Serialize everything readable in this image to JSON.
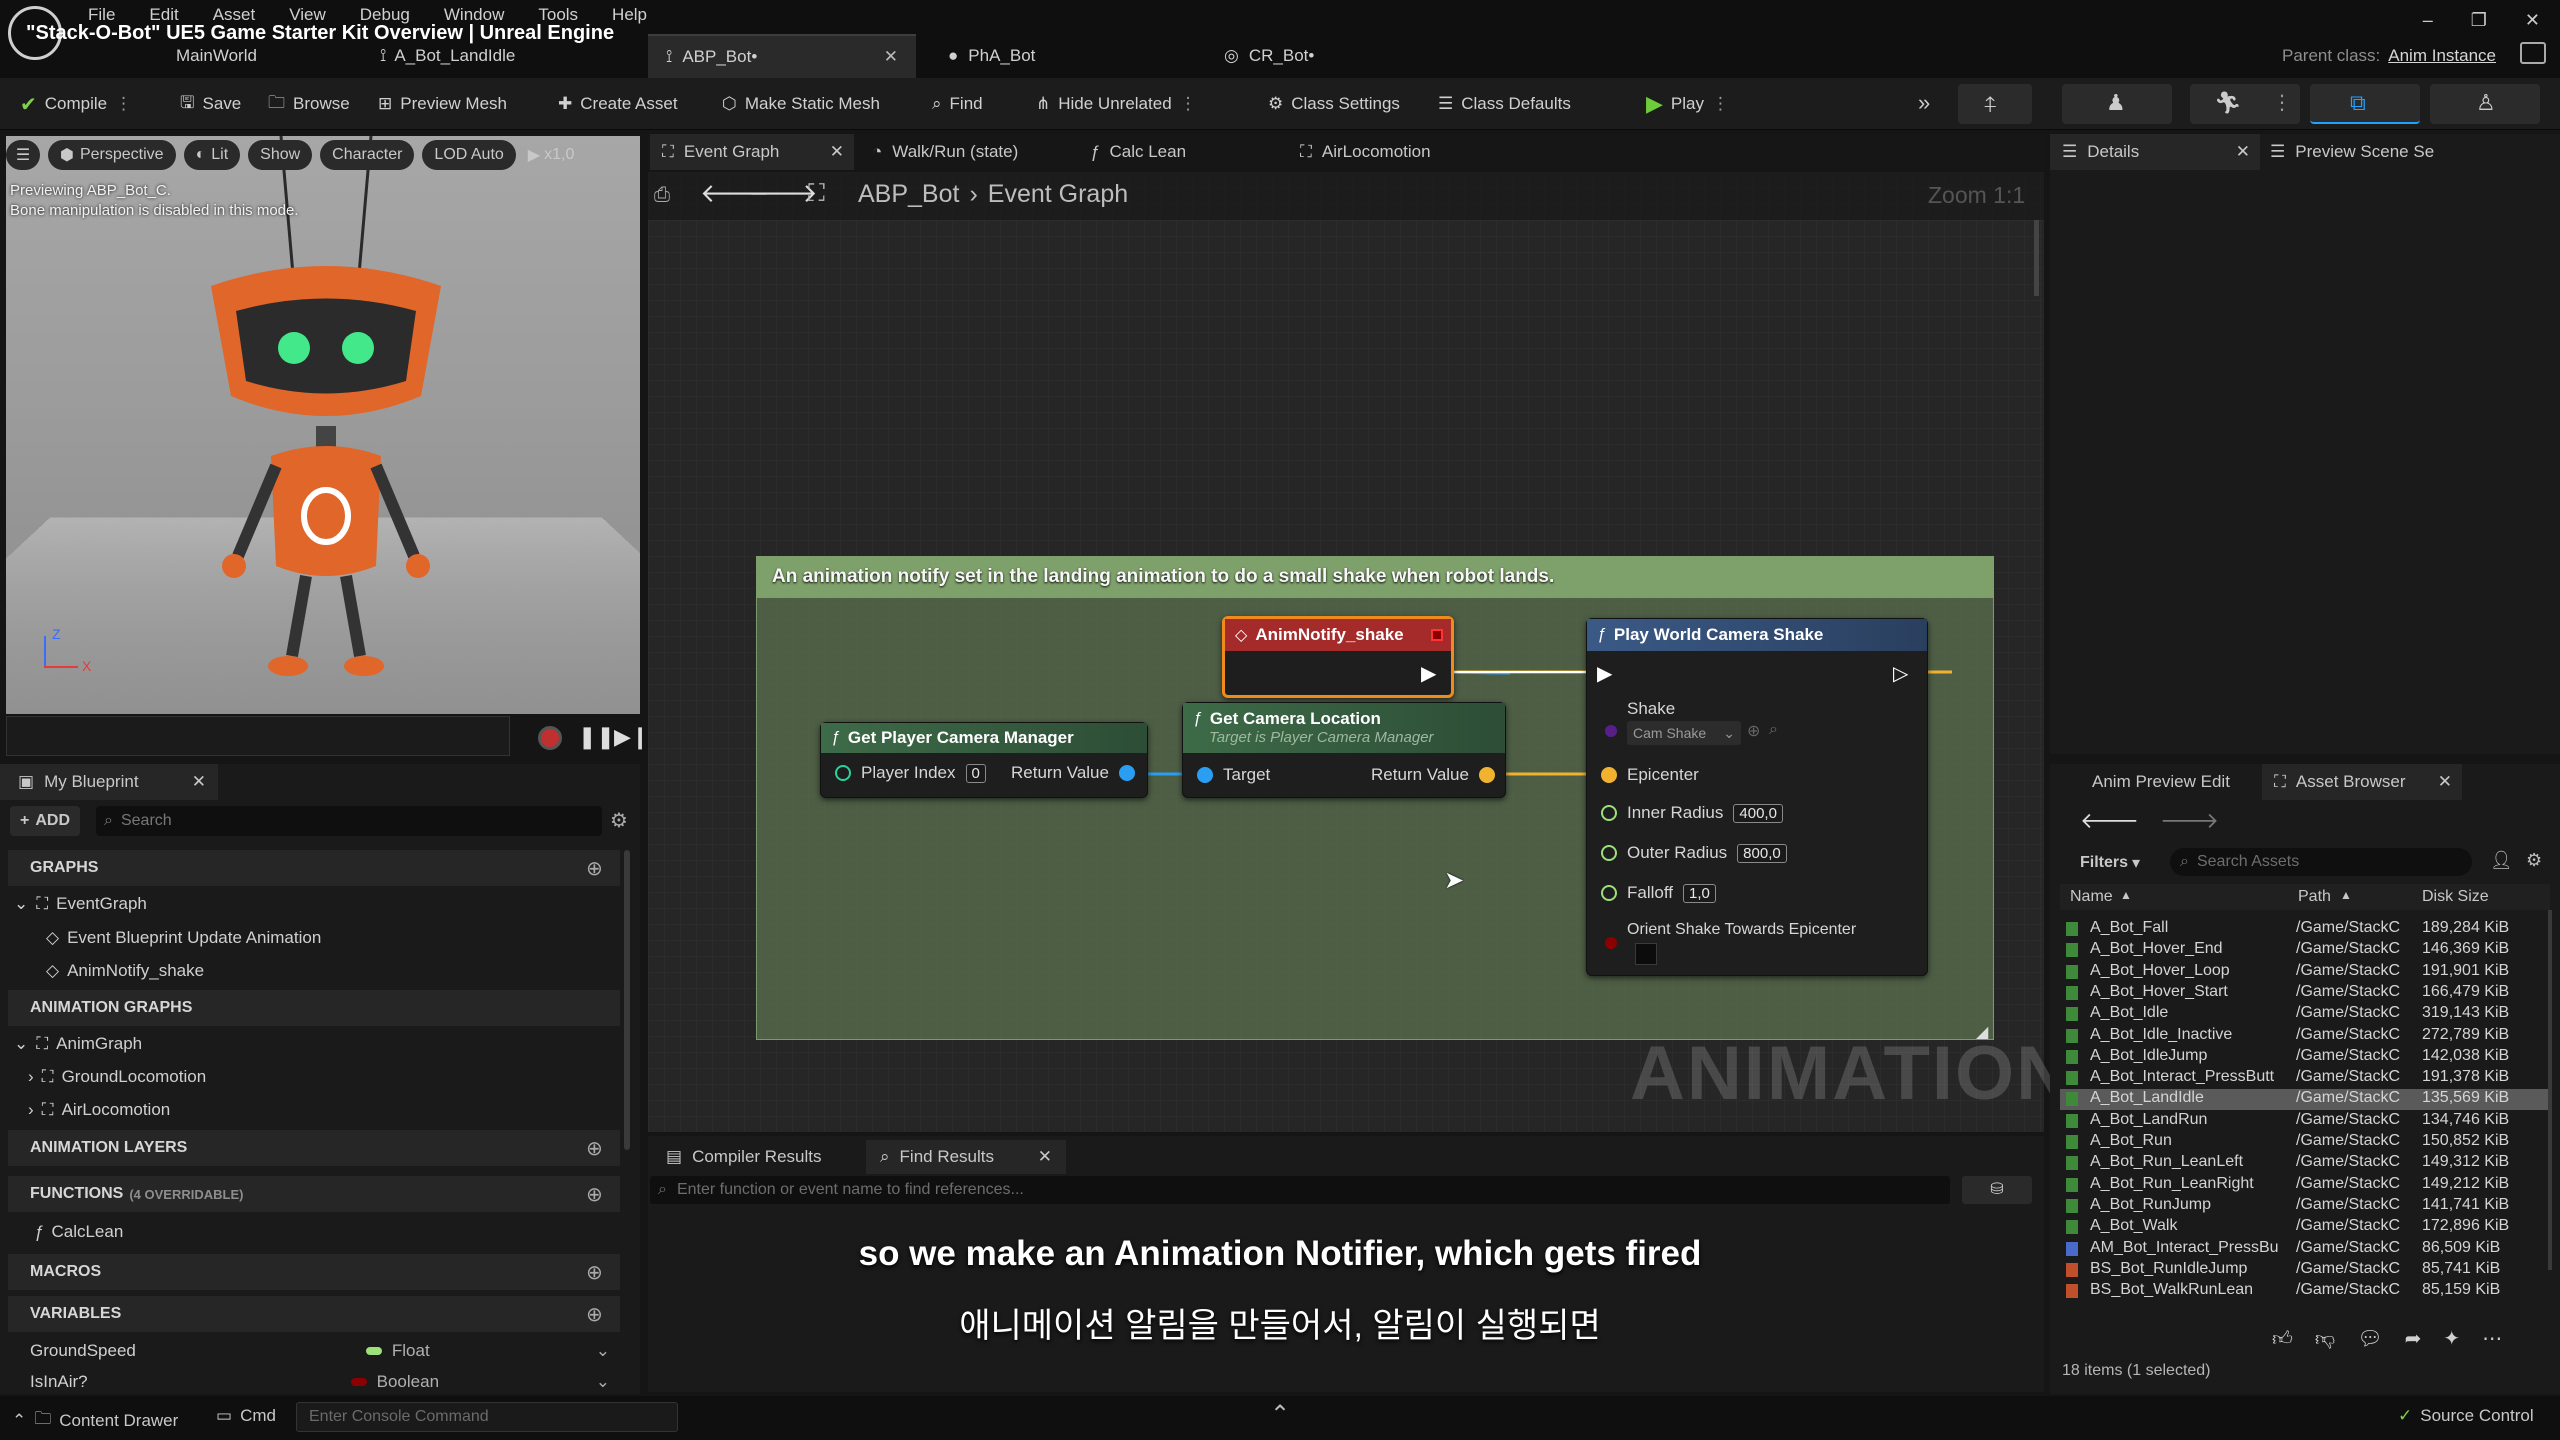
{
  "app": {
    "title": "\"Stack-O-Bot\" UE5 Game Starter Kit Overview | Unreal Engine",
    "main_world": "MainWorld",
    "tab_landidle": "A_Bot_LandIdle",
    "parent_class_label": "Parent class:",
    "parent_class_value": "Anim Instance"
  },
  "menu": [
    "File",
    "Edit",
    "Asset",
    "View",
    "Debug",
    "Window",
    "Tools",
    "Help"
  ],
  "doc_tabs": [
    "ABP_Bot•",
    "PhA_Bot",
    "CR_Bot•"
  ],
  "toolbar": {
    "compile": "Compile",
    "save": "Save",
    "browse": "Browse",
    "preview_mesh": "Preview Mesh",
    "create_asset": "Create Asset",
    "make_static_mesh": "Make Static Mesh",
    "find": "Find",
    "hide_unrelated": "Hide Unrelated",
    "class_settings": "Class Settings",
    "class_defaults": "Class Defaults",
    "play": "Play"
  },
  "viewport": {
    "perspective": "Perspective",
    "lit": "Lit",
    "show": "Show",
    "character": "Character",
    "lod": "LOD Auto",
    "speed": "x1,0",
    "preview_line1": "Previewing ABP_Bot_C.",
    "preview_line2": "Bone manipulation is disabled in this mode.",
    "axis_z": "Z",
    "axis_x": "X"
  },
  "my_blueprint": {
    "title": "My Blueprint",
    "add": "ADD",
    "search_placeholder": "Search",
    "graphs": "GRAPHS",
    "event_graph": "EventGraph",
    "event_bp_update": "Event Blueprint Update Animation",
    "anim_notify": "AnimNotify_shake",
    "animation_graphs": "ANIMATION GRAPHS",
    "anim_graph": "AnimGraph",
    "ground_locomotion": "GroundLocomotion",
    "air_locomotion": "AirLocomotion",
    "animation_layers": "ANIMATION LAYERS",
    "functions": "FUNCTIONS",
    "functions_note": "(4 OVERRIDABLE)",
    "calc_lean": "CalcLean",
    "macros": "MACROS",
    "variables": "VARIABLES",
    "var1_name": "GroundSpeed",
    "var1_type": "Float",
    "var2_name": "IsInAir?",
    "var2_type": "Boolean"
  },
  "graph_tabs": [
    "Event Graph",
    "Walk/Run (state)",
    "Calc Lean",
    "AirLocomotion"
  ],
  "breadcrumb": {
    "bp": "ABP_Bot",
    "graph": "Event Graph",
    "zoom": "Zoom 1:1"
  },
  "comment": "An animation notify set in the landing animation to do a small shake when robot lands.",
  "nodes": {
    "anim_notify": "AnimNotify_shake",
    "get_pcm": {
      "title": "Get Player Camera Manager",
      "player_index": "Player Index",
      "player_index_val": "0",
      "return_value": "Return Value"
    },
    "get_cam_loc": {
      "title": "Get Camera Location",
      "subtitle": "Target is Player Camera Manager",
      "target": "Target",
      "return_value": "Return Value"
    },
    "play_shake": {
      "title": "Play World Camera Shake",
      "shake": "Shake",
      "shake_val": "Cam Shake",
      "epicenter": "Epicenter",
      "inner_radius": "Inner Radius",
      "inner_radius_val": "400,0",
      "outer_radius": "Outer Radius",
      "outer_radius_val": "800,0",
      "falloff": "Falloff",
      "falloff_val": "1,0",
      "orient": "Orient Shake Towards Epicenter"
    }
  },
  "watermark": "ANIMATION",
  "bottom_tabs": {
    "compiler_results": "Compiler Results",
    "find_results": "Find Results",
    "find_placeholder": "Enter function or event name to find references..."
  },
  "subtitles": {
    "en": "so we make an Animation Notifier, which gets fired",
    "ko": "애니메이션 알림을 만들어서, 알림이 실행되면"
  },
  "details": {
    "title": "Details",
    "preview_scene": "Preview Scene Se"
  },
  "asset_browser": {
    "anim_preview_tab": "Anim Preview Edit",
    "title": "Asset Browser",
    "filters": "Filters",
    "search_placeholder": "Search Assets",
    "col_name": "Name",
    "col_path": "Path",
    "col_size": "Disk Size",
    "footer": "18 items (1 selected)",
    "rows": [
      {
        "name": "A_Bot_Fall",
        "path": "/Game/StackC",
        "size": "189,284 KiB"
      },
      {
        "name": "A_Bot_Hover_End",
        "path": "/Game/StackC",
        "size": "146,369 KiB"
      },
      {
        "name": "A_Bot_Hover_Loop",
        "path": "/Game/StackC",
        "size": "191,901 KiB"
      },
      {
        "name": "A_Bot_Hover_Start",
        "path": "/Game/StackC",
        "size": "166,479 KiB"
      },
      {
        "name": "A_Bot_Idle",
        "path": "/Game/StackC",
        "size": "319,143 KiB"
      },
      {
        "name": "A_Bot_Idle_Inactive",
        "path": "/Game/StackC",
        "size": "272,789 KiB"
      },
      {
        "name": "A_Bot_IdleJump",
        "path": "/Game/StackC",
        "size": "142,038 KiB"
      },
      {
        "name": "A_Bot_Interact_PressButt",
        "path": "/Game/StackC",
        "size": "191,378 KiB"
      },
      {
        "name": "A_Bot_LandIdle",
        "path": "/Game/StackC",
        "size": "135,569 KiB"
      },
      {
        "name": "A_Bot_LandRun",
        "path": "/Game/StackC",
        "size": "134,746 KiB"
      },
      {
        "name": "A_Bot_Run",
        "path": "/Game/StackC",
        "size": "150,852 KiB"
      },
      {
        "name": "A_Bot_Run_LeanLeft",
        "path": "/Game/StackC",
        "size": "149,312 KiB"
      },
      {
        "name": "A_Bot_Run_LeanRight",
        "path": "/Game/StackC",
        "size": "149,212 KiB"
      },
      {
        "name": "A_Bot_RunJump",
        "path": "/Game/StackC",
        "size": "141,741 KiB"
      },
      {
        "name": "A_Bot_Walk",
        "path": "/Game/StackC",
        "size": "172,896 KiB"
      },
      {
        "name": "AM_Bot_Interact_PressBu",
        "path": "/Game/StackC",
        "size": "86,509 KiB"
      },
      {
        "name": "BS_Bot_RunIdleJump",
        "path": "/Game/StackC",
        "size": "85,741 KiB"
      },
      {
        "name": "BS_Bot_WalkRunLean",
        "path": "/Game/StackC",
        "size": "85,159 KiB"
      }
    ]
  },
  "statusbar": {
    "content_drawer": "Content Drawer",
    "cmd": "Cmd",
    "console_placeholder": "Enter Console Command",
    "source_control": "Source Control"
  },
  "colors": {
    "accent": "#1fa3ff",
    "comment_bg": "#5c7a4e",
    "comment_header": "#7fa06a",
    "selected_row": "#5a5a5a"
  }
}
